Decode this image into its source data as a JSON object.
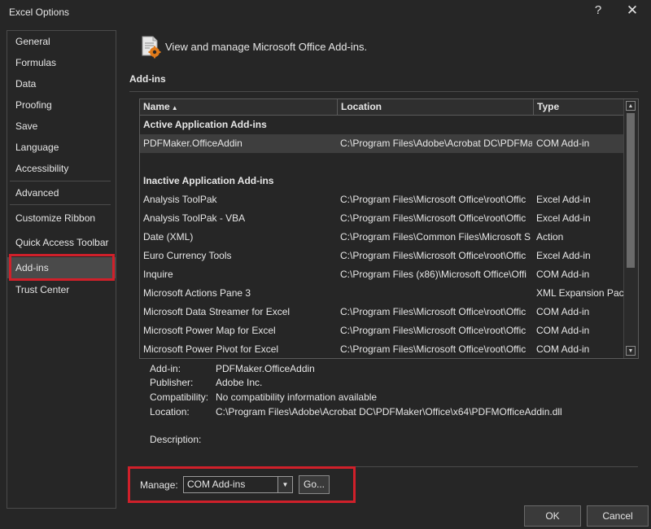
{
  "window": {
    "title": "Excel Options",
    "help_glyph": "?",
    "close_glyph": "✕"
  },
  "sidebar": {
    "items": [
      {
        "label": "General"
      },
      {
        "label": "Formulas"
      },
      {
        "label": "Data"
      },
      {
        "label": "Proofing"
      },
      {
        "label": "Save"
      },
      {
        "label": "Language"
      },
      {
        "label": "Accessibility"
      },
      {
        "label": "Advanced"
      },
      {
        "label": "Customize Ribbon"
      },
      {
        "label": "Quick Access Toolbar"
      },
      {
        "label": "Add-ins"
      },
      {
        "label": "Trust Center"
      }
    ],
    "selected": "Add-ins",
    "highlight_color": "#d0202a"
  },
  "header": {
    "text": "View and manage Microsoft Office Add-ins.",
    "icon": "addins-gear-document-icon"
  },
  "section": {
    "label": "Add-ins"
  },
  "table": {
    "columns": [
      "Name",
      "Location",
      "Type"
    ],
    "sort_indicator": "▲",
    "rows": [
      {
        "group": "Active Application Add-ins"
      },
      {
        "name": "PDFMaker.OfficeAddin",
        "location": "C:\\Program Files\\Adobe\\Acrobat DC\\PDFMa",
        "type": "COM Add-in",
        "selected": true
      },
      {
        "spacer": true
      },
      {
        "group": "Inactive Application Add-ins"
      },
      {
        "name": "Analysis ToolPak",
        "location": "C:\\Program Files\\Microsoft Office\\root\\Offic",
        "type": "Excel Add-in"
      },
      {
        "name": "Analysis ToolPak - VBA",
        "location": "C:\\Program Files\\Microsoft Office\\root\\Offic",
        "type": "Excel Add-in"
      },
      {
        "name": "Date (XML)",
        "location": "C:\\Program Files\\Common Files\\Microsoft S",
        "type": "Action"
      },
      {
        "name": "Euro Currency Tools",
        "location": "C:\\Program Files\\Microsoft Office\\root\\Offic",
        "type": "Excel Add-in"
      },
      {
        "name": "Inquire",
        "location": "C:\\Program Files (x86)\\Microsoft Office\\Offi",
        "type": "COM Add-in"
      },
      {
        "name": "Microsoft Actions Pane 3",
        "location": "",
        "type": "XML Expansion Pack"
      },
      {
        "name": "Microsoft Data Streamer for Excel",
        "location": "C:\\Program Files\\Microsoft Office\\root\\Offic",
        "type": "COM Add-in"
      },
      {
        "name": "Microsoft Power Map for Excel",
        "location": "C:\\Program Files\\Microsoft Office\\root\\Offic",
        "type": "COM Add-in"
      },
      {
        "name": "Microsoft Power Pivot for Excel",
        "location": "C:\\Program Files\\Microsoft Office\\root\\Offic",
        "type": "COM Add-in"
      }
    ],
    "scroll_up_glyph": "▲",
    "scroll_down_glyph": "▼"
  },
  "details": [
    {
      "label": "Add-in:",
      "value": "PDFMaker.OfficeAddin"
    },
    {
      "label": "Publisher:",
      "value": "Adobe Inc."
    },
    {
      "label": "Compatibility:",
      "value": "No compatibility information available"
    },
    {
      "label": "Location:",
      "value": "C:\\Program Files\\Adobe\\Acrobat DC\\PDFMaker\\Office\\x64\\PDFMOfficeAddin.dll"
    },
    {
      "label": "Description:",
      "value": ""
    }
  ],
  "manage": {
    "label": "Manage:",
    "value": "COM Add-ins",
    "dropdown_glyph": "▼",
    "go_label": "Go..."
  },
  "buttons": {
    "ok": "OK",
    "cancel": "Cancel"
  }
}
